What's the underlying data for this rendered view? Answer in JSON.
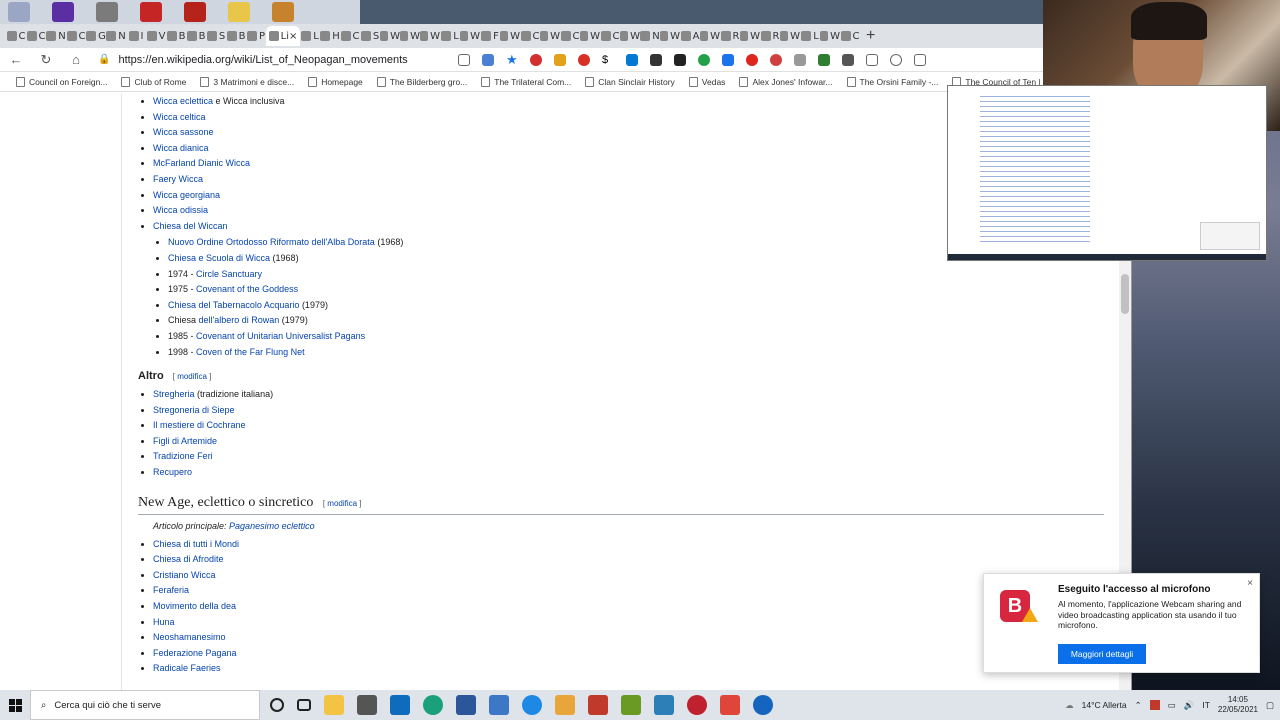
{
  "browser": {
    "url": "https://en.wikipedia.org/wiki/List_of_Neopagan_movements",
    "active_tab_label": "Li",
    "tab_letters": [
      "C",
      "C",
      "N",
      "C",
      "G",
      "N",
      "I",
      "V",
      "B",
      "B",
      "S",
      "B",
      "P",
      "Li",
      "L",
      "H",
      "C",
      "S",
      "W",
      "W",
      "W",
      "L",
      "W",
      "F",
      "W",
      "C",
      "W",
      "C",
      "W",
      "C",
      "W",
      "N",
      "W",
      "A",
      "W",
      "R",
      "W",
      "R",
      "W",
      "L",
      "W",
      "C"
    ],
    "new_tab_label": "+"
  },
  "bookmarks": [
    "Council on Foreign...",
    "Club of Rome",
    "3 Matrimoni e disce...",
    "Homepage",
    "The Bilderberg gro...",
    "The Trilateral Com...",
    "Clan Sinclair History",
    "Vedas",
    "Alex Jones' Infowar...",
    "The Orsini Family -...",
    "The Council of Ten |"
  ],
  "article": {
    "wicca_list": [
      {
        "link": "Wicca eclettica",
        "rest": " e Wicca inclusiva"
      },
      {
        "link": "Wicca celtica",
        "rest": ""
      },
      {
        "link": "Wicca sassone",
        "rest": ""
      },
      {
        "link": "Wicca dianica",
        "rest": ""
      },
      {
        "link": "McFarland Dianic Wicca",
        "rest": ""
      },
      {
        "link": "Faery Wicca",
        "rest": ""
      },
      {
        "link": "Wicca georgiana",
        "rest": ""
      },
      {
        "link": "Wicca odissia",
        "rest": ""
      },
      {
        "link": "Chiesa del Wiccan",
        "rest": ""
      }
    ],
    "wiccan_sub": [
      {
        "pre": "",
        "link": "Nuovo Ordine Ortodosso Riformato dell'Alba Dorata",
        "rest": " (1968)"
      },
      {
        "pre": "",
        "link": "Chiesa e Scuola di Wicca",
        "rest": " (1968)"
      },
      {
        "pre": "1974 - ",
        "link": "Circle Sanctuary",
        "rest": ""
      },
      {
        "pre": "1975 - ",
        "link": "Covenant of the Goddess",
        "rest": ""
      },
      {
        "pre": "",
        "link": "Chiesa del Tabernacolo Acquario",
        "rest": " (1979)"
      },
      {
        "pre": "Chiesa ",
        "link": "dell'albero di Rowan",
        "rest": " (1979)"
      },
      {
        "pre": "1985 - ",
        "link": "Covenant of Unitarian Universalist Pagans",
        "rest": ""
      },
      {
        "pre": "1998 - ",
        "link": "Coven of the Far Flung Net",
        "rest": ""
      }
    ],
    "altro_heading": "Altro",
    "edit_label": "modifica",
    "altro_list": [
      {
        "link": "Stregheria",
        "rest": " (tradizione italiana)"
      },
      {
        "link": "Stregoneria di Siepe",
        "rest": ""
      },
      {
        "link": "Il mestiere di Cochrane",
        "rest": ""
      },
      {
        "link": "Figli di Artemide",
        "rest": ""
      },
      {
        "link": "Tradizione Feri",
        "rest": ""
      },
      {
        "link": "Recupero",
        "rest": ""
      }
    ],
    "newage_heading": "New Age, eclettico o sincretico",
    "hatnote_prefix": "Articolo principale: ",
    "hatnote_link": "Paganesimo eclettico",
    "newage_list": [
      "Chiesa di tutti i Mondi",
      "Chiesa di Afrodite",
      "Cristiano Wicca",
      "Feraferia",
      "Movimento della dea",
      "Huna",
      "Neoshamanesimo",
      "Federazione Pagana",
      "Radicale Faeries"
    ]
  },
  "notification": {
    "logo_letter": "B",
    "title": "Eseguito l'accesso al microfono",
    "text": "Al momento, l'applicazione Webcam sharing and video broadcasting application sta usando il tuo microfono.",
    "button": "Maggiori dettagli",
    "close": "×"
  },
  "taskbar": {
    "search_placeholder": "Cerca qui ciò che ti serve",
    "weather": "14°C  Allerta",
    "time": "14:05",
    "date": "22/05/2021"
  },
  "colors": {
    "link": "#0645ad",
    "brave_red": "#d7263d",
    "button_blue": "#0a6fe8"
  }
}
